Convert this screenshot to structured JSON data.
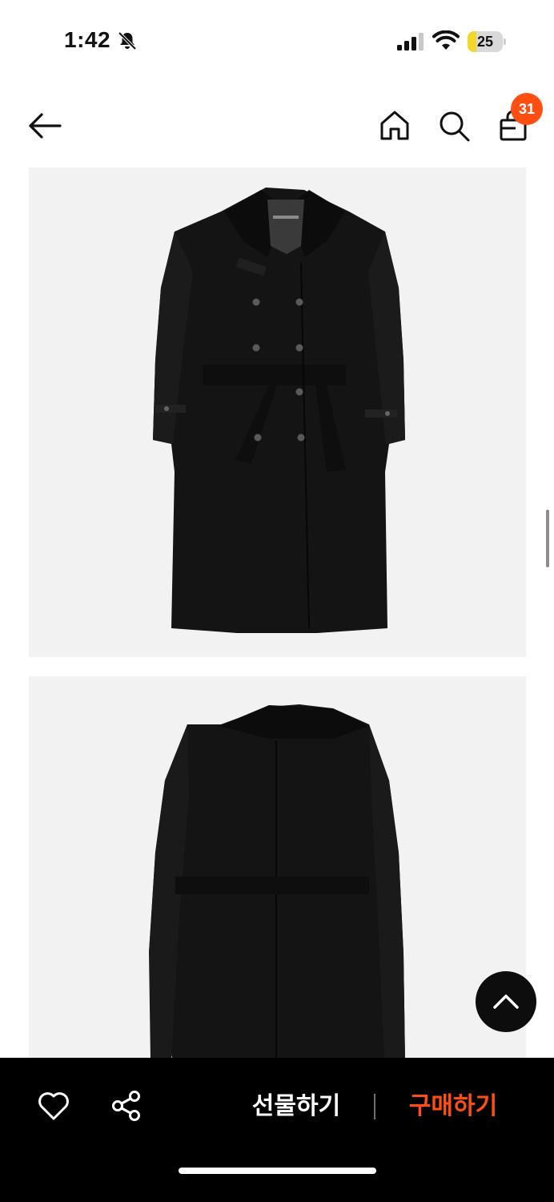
{
  "status_bar": {
    "time": "1:42",
    "battery_level": "25",
    "battery_color": "#f3d72a"
  },
  "top_nav": {
    "back_icon": "arrow-left-icon",
    "home_icon": "home-icon",
    "search_icon": "search-icon",
    "cart_icon": "shopping-bag-icon",
    "cart_count": "31",
    "badge_color": "#ff4e12"
  },
  "product": {
    "images": [
      {
        "view": "front",
        "description_icon": "coat-front-image"
      },
      {
        "view": "back",
        "description_icon": "coat-back-image"
      }
    ]
  },
  "floating": {
    "scroll_top_icon": "chevron-up-icon"
  },
  "bottom_bar": {
    "wishlist_icon": "heart-icon",
    "share_icon": "share-icon",
    "gift_label": "선물하기",
    "buy_label": "구매하기",
    "accent_color": "#ff4e12"
  }
}
